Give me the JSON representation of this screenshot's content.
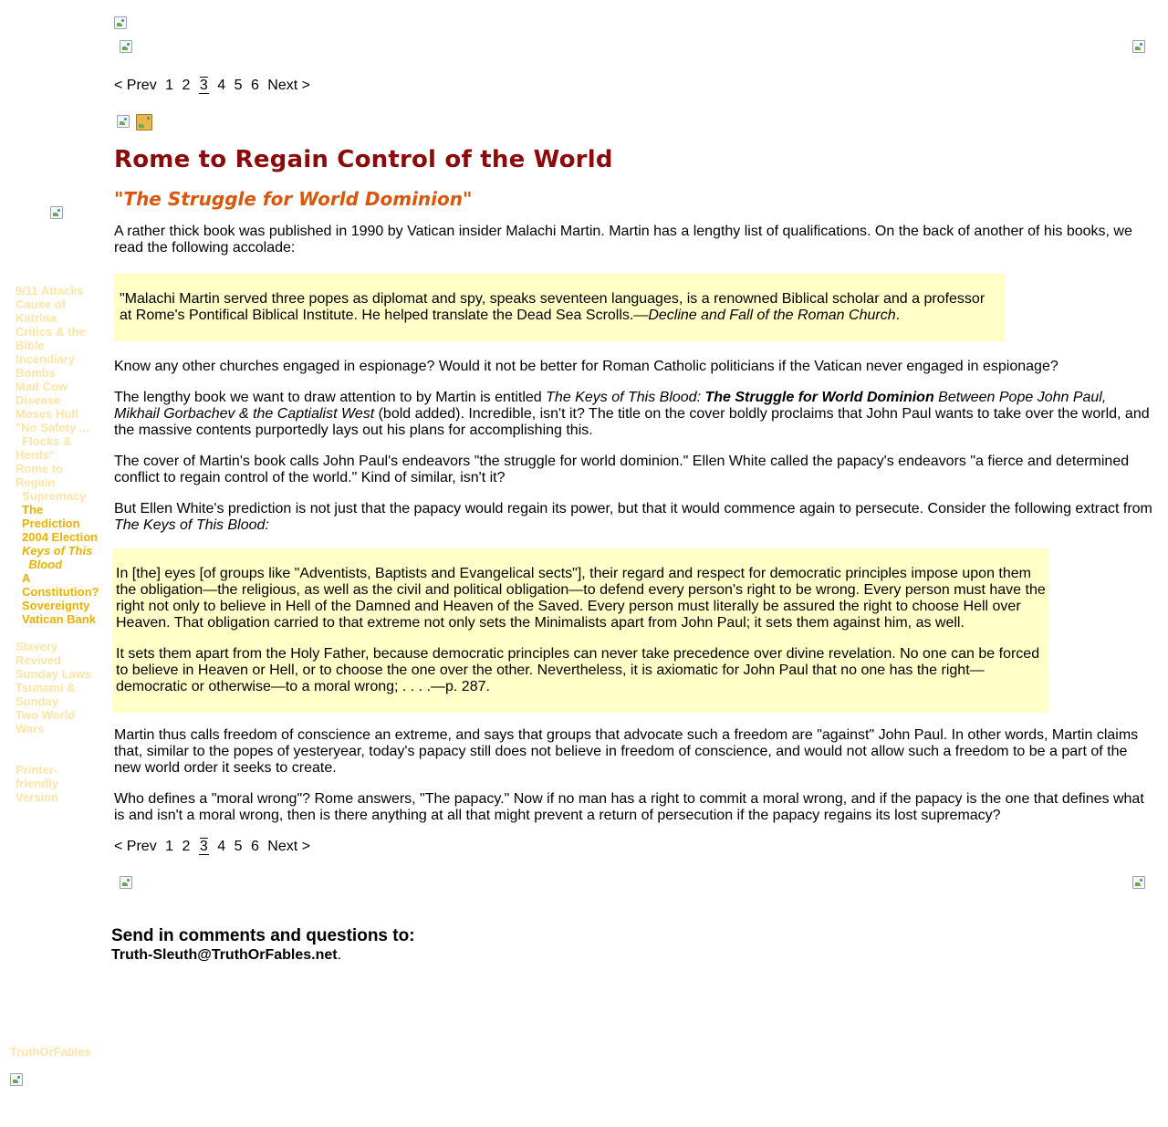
{
  "pager": {
    "prev": "< Prev",
    "pages": [
      "1",
      "2",
      "3",
      "4",
      "5",
      "6"
    ],
    "current": "3",
    "next": "Next >"
  },
  "sidebar": {
    "items": [
      "9/11 Attacks",
      "Cause of\nKatrina",
      "Critics & the\nBible",
      "Incendiary\nBombs",
      "Mad Cow\nDisease",
      "Moses Hull",
      "\"No Safety ...\n  Flocks &\nHerds\"",
      "Rome to\nRegain\n  Supremacy",
      "The\nPrediction",
      "2004 Election",
      "Keys of This\n  Blood",
      "A\nConstitution?",
      "Sovereignty",
      "Vatican Bank",
      "Slavery\nRevived",
      "Sunday Laws",
      "Tsunami &\nSunday",
      "Two World\nWars",
      "Printer-\nfriendly\nVersion"
    ],
    "footer": "TruthOrFables"
  },
  "article": {
    "title": "Rome to Regain Control of the World",
    "subtitle": "\"The Struggle for World Dominion\"",
    "intro": "A rather thick book was published in 1990 by Vatican insider Malachi Martin. Martin has a lengthy list of qualifications. On the back of another of his books, we read the following accolade:",
    "quote1_text": "\"Malachi Martin served three popes as diplomat and spy, speaks seventeen languages, is a renowned Biblical scholar and a professor at Rome's Pontifical Biblical Institute. He helped translate the Dead Sea Scrolls.—",
    "quote1_source": "Decline and Fall of the Roman Church",
    "p2": "Know any other churches engaged in espionage? Would it not be better for Roman Catholic politicians if the Vatican never engaged in espionage?",
    "p3_a": "The lengthy book we want to draw attention to by Martin is entitled ",
    "p3_book_a": "The Keys of This Blood: ",
    "p3_book_bold": "The Struggle for World Dominion",
    "p3_book_b": " Between Pope John Paul, Mikhail Gorbachev & the Captialist West",
    "p3_b": " (bold added). Incredible, isn't it? The title on the cover boldly proclaims that John Paul wants to take over the world, and the massive contents purportedly lays out his plans for accomplishing this.",
    "p4": "The cover of Martin's book calls John Paul's endeavors \"the struggle for world dominion.\" Ellen White called the papacy's endeavors \"a fierce and determined conflict to regain control of the world.\" Kind of similar, isn't it?",
    "p5_a": "But Ellen White's prediction is not just that the papacy would regain its power, but that it would commence again to persecute. Consider the following extract from ",
    "p5_book": "The Keys of This Blood:",
    "quote2_p1": "In [the] eyes [of groups like \"Adventists, Baptists and Evangelical sects\"], their regard and respect for democratic principles impose upon them the obligation—the religious, as well as the civil and political obligation—to defend every person's right to be wrong. Every person must have the right not only to believe in Hell of the Damned and Heaven of the Saved. Every person must literally be assured the right to choose Hell over Heaven. That obligation carried to that extreme not only sets the Minimalists apart from John Paul; it sets them against him, as well.",
    "quote2_p2": "It sets them apart from the Holy Father, because democratic principles can never take precedence over divine revelation. No one can be forced to believe in Heaven or Hell, or to choose the one over the other. Nevertheless, it is axiomatic for John Paul that no one has the right—democratic or otherwise—to a moral wrong; . . . .—p. 287.",
    "p6": "Martin thus calls freedom of conscience an extreme, and says that groups that advocate such a freedom are \"against\" John Paul. In other words, Martin claims that, similar to the popes of yesteryear, today's papacy still does not believe in freedom of conscience, and would not allow such a freedom to be a part of the new world order it seeks to create.",
    "p7": "Who defines a \"moral wrong\"? Rome answers, \"The papacy.\" Now if no man has a right to commit a moral wrong, and if the papacy is the one that defines what is and isn't a moral wrong, then is there anything at all that might prevent a return of persecution if the papacy regains its lost supremacy?"
  },
  "contact": {
    "heading": "Send in comments and questions to:",
    "email": "Truth-Sleuth@TruthOrFables.net",
    "period": "."
  },
  "colors": {
    "title": "#8b0a0a",
    "subtitle": "#d9560b",
    "quote_bg": "#ffffc8",
    "nav_link": "#ffe4a8",
    "nav_current": "#e8b200"
  }
}
